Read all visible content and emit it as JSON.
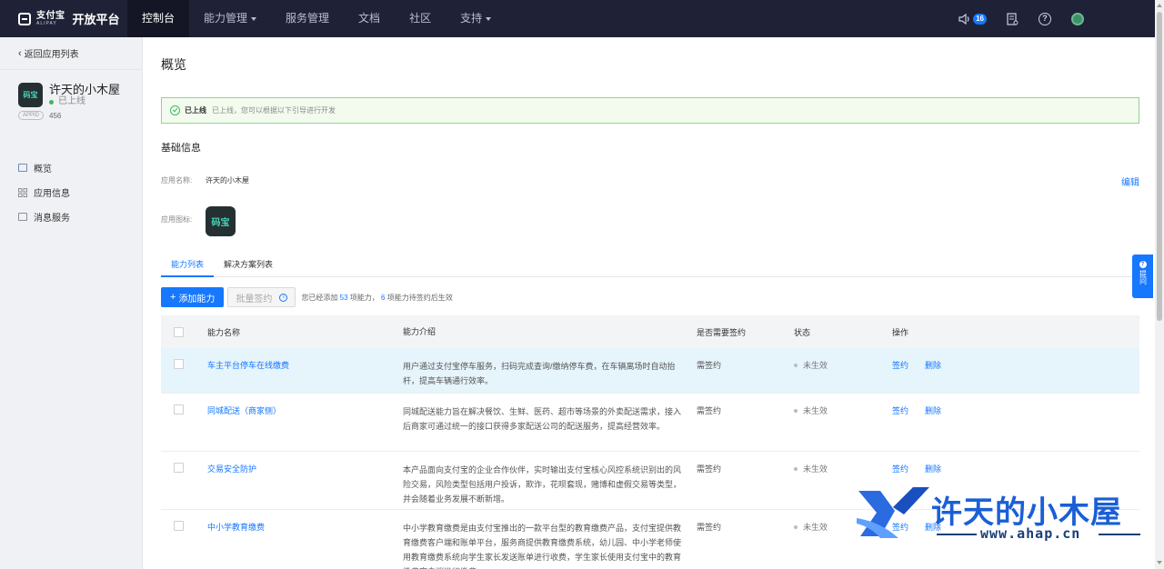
{
  "brand": {
    "name_cn": "支付宝",
    "name_en": "ALIPAY",
    "platform": "开放平台"
  },
  "nav": [
    {
      "label": "控制台",
      "active": true,
      "dropdown": false
    },
    {
      "label": "能力管理",
      "active": false,
      "dropdown": true
    },
    {
      "label": "服务管理",
      "active": false,
      "dropdown": false
    },
    {
      "label": "文档",
      "active": false,
      "dropdown": false
    },
    {
      "label": "社区",
      "active": false,
      "dropdown": false
    },
    {
      "label": "支持",
      "active": false,
      "dropdown": true
    }
  ],
  "top_right": {
    "notification_count": "16",
    "icons": [
      "speaker-icon",
      "document-icon",
      "help-icon",
      "avatar"
    ]
  },
  "sidebar": {
    "back_label": "返回应用列表",
    "app_name": "许天的小木屋",
    "app_icon_text": "码宝",
    "status": "已上线",
    "appid_tag": "APPID",
    "appid_value": "456",
    "menu": [
      {
        "label": "概览",
        "icon": "monitor-icon"
      },
      {
        "label": "应用信息",
        "icon": "grid-icon"
      },
      {
        "label": "消息服务",
        "icon": "screen-icon"
      }
    ]
  },
  "main": {
    "title": "概览",
    "alert": {
      "status": "已上线",
      "message": "已上线，您可以根据以下引导进行开发"
    },
    "basic_info_title": "基础信息",
    "app_name_label": "应用名称:",
    "app_name_value": "许天的小木屋",
    "app_icon_label": "应用图标:",
    "edit_label": "编辑",
    "tabs": [
      "能力列表",
      "解决方案列表"
    ],
    "add_button": "添加能力",
    "batch_button": "批量签约",
    "summary_prefix": "您已经添加",
    "added_count": "53",
    "summary_mid": "项能力，",
    "pending_count": "6",
    "summary_suffix": "项能力待签约后生效"
  },
  "table": {
    "headers": [
      "能力名称",
      "能力介绍",
      "是否需要签约",
      "状态",
      "操作"
    ],
    "rows": [
      {
        "name": "车主平台停车在线缴费",
        "desc": "用户通过支付宝停车服务，扫码完成查询/缴纳停车费，在车辆离场时自动抬杆，提高车辆通行效率。",
        "sign": "需签约",
        "state": "未生效",
        "op1": "签约",
        "op2": "删除"
      },
      {
        "name": "同城配送（商家侧）",
        "desc": "同城配送能力旨在解决餐饮、生鲜、医药、超市等场景的外卖配送需求，接入后商家可通过统一的接口获得多家配送公司的配送服务，提高经营效率。",
        "sign": "需签约",
        "state": "未生效",
        "op1": "签约",
        "op2": "删除"
      },
      {
        "name": "交易安全防护",
        "desc": "本产品面向支付宝的企业合作伙伴，实时输出支付宝核心风控系统识别出的风险交易，风险类型包括用户投诉，欺诈，花呗套现，赌博和虚假交易等类型，并会随着业务发展不断新增。",
        "sign": "需签约",
        "state": "未生效",
        "op1": "签约",
        "op2": "删除"
      },
      {
        "name": "中小学教育缴费",
        "desc": "中小学教育缴费是由支付宝推出的一款平台型的教育缴费产品，支付宝提供教育缴费客户端和账单平台，服务商提供教育缴费系统，幼儿园、中小学老师使用教育缴费系统向学生家长发送账单进行收费，学生家长使用支付宝中的教育缴费客户端进行缴费。",
        "sign": "需签约",
        "state": "未生效",
        "op1": "签约",
        "op2": "删除"
      }
    ]
  },
  "ask_button": {
    "label": "提问"
  },
  "watermark": {
    "text": "许天的小木屋",
    "url": "www.ahap.cn"
  },
  "colors": {
    "nav_bg": "#1f2236",
    "primary": "#1677ff",
    "success": "#3db85c",
    "highlight_row": "#e6f4fc"
  }
}
